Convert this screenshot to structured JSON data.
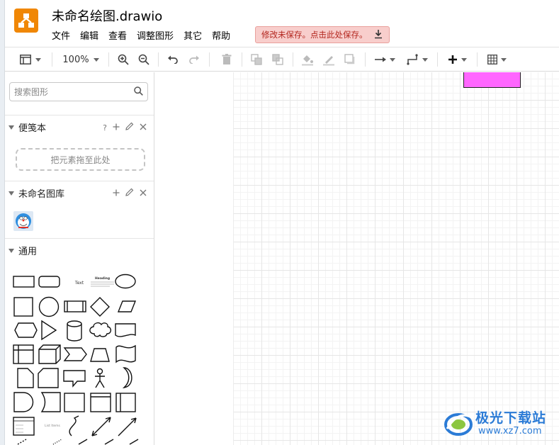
{
  "app": {
    "title": "未命名绘图.drawio",
    "menu": [
      "文件",
      "编辑",
      "查看",
      "调整图形",
      "其它",
      "帮助"
    ],
    "unsaved_notice": "修改未保存。点击此处保存。",
    "colors": {
      "logo": "#f08705",
      "unsaved_bg": "#f8cecc",
      "unsaved_text": "#b3261e",
      "shape_fill": "#ff66ff"
    }
  },
  "toolbar": {
    "zoom": "100%",
    "icons": [
      "layout-icon",
      "zoom-in-icon",
      "zoom-out-icon",
      "undo-icon",
      "redo-icon",
      "delete-icon",
      "to-front-icon",
      "to-back-icon",
      "fill-color-icon",
      "line-color-icon",
      "shadow-icon",
      "connection-icon",
      "waypoints-icon",
      "insert-icon",
      "table-icon"
    ]
  },
  "sidebar": {
    "search_placeholder": "搜索图形",
    "scratchpad": {
      "title": "便笺本",
      "help": "?",
      "drop_hint": "把元素拖至此处"
    },
    "library": {
      "title": "未命名图库"
    },
    "general": {
      "title": "通用"
    },
    "shape_text": "Text",
    "shape_heading": "Heading",
    "shape_list": "List Items"
  },
  "watermark": {
    "line1": "极光下载站",
    "line2": "www.xz7.com"
  }
}
